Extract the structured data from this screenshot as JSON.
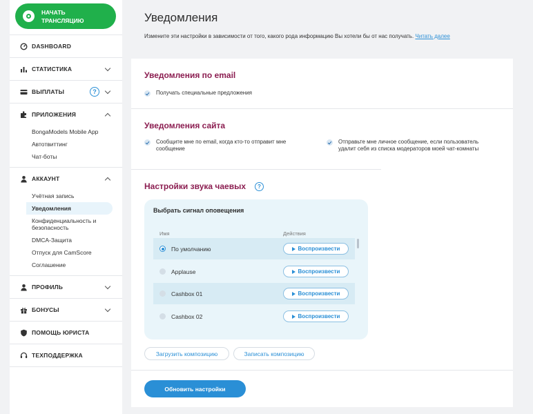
{
  "sidebar": {
    "start_button": "НАЧАТЬ\nТРАНСЛЯЦИЮ",
    "dashboard": "DASHBOARD",
    "stats": "СТАТИСТИКА",
    "payouts": "ВЫПЛАТЫ",
    "payouts_help": "?",
    "apps": "ПРИЛОЖЕНИЯ",
    "apps_items": [
      "BongaModels Mobile App",
      "Автотвиттинг",
      "Чат-боты"
    ],
    "account": "АККАУНТ",
    "account_items": [
      "Учётная запись",
      "Уведомления",
      "Конфиденциальность и безопасность",
      "DMCA-Защита",
      "Отпуск для CamScore",
      "Соглашение"
    ],
    "profile": "ПРОФИЛЬ",
    "bonuses": "БОНУСЫ",
    "lawyer": "ПОМОЩЬ ЮРИСТА",
    "support": "ТЕХПОДДЕРЖКА"
  },
  "main": {
    "title": "Уведомления",
    "description": "Измените эти настройки в зависимости от того, какого рода информацию Вы хотели бы от нас получать.",
    "read_more": "Читать далее",
    "email": {
      "heading": "Уведомления по email",
      "option": "Получать специальные предложения"
    },
    "site": {
      "heading": "Уведомления сайта",
      "option1": "Сообщите мне по email, когда кто-то отправит мне сообщение",
      "option2": "Отправьте мне личное сообщение, если пользователь удалит себя из списка модераторов моей чат-комнаты"
    },
    "sound": {
      "heading": "Настройки звука чаевых",
      "help": "?",
      "panel_title": "Выбрать сигнал оповещения",
      "col_name": "Имя",
      "col_actions": "Действия",
      "play_label": "Воспроизвести",
      "rows": [
        "По умолчанию",
        "Applause",
        "Cashbox 01",
        "Cashbox 02"
      ],
      "selected": "По умолчанию",
      "upload": "Загрузить композицию",
      "record": "Записать композицию"
    },
    "update_button": "Обновить настройки"
  },
  "colors": {
    "green": "#20b04b",
    "blue": "#2a8fd6",
    "heading": "#8b1d50"
  }
}
